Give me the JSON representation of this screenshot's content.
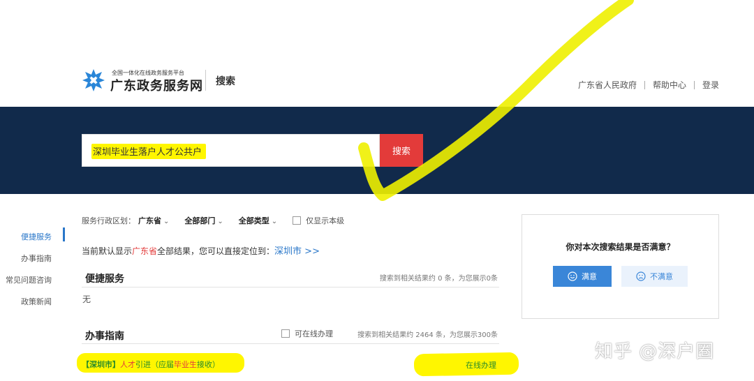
{
  "header": {
    "logo_sub": "全国一体化在线政务服务平台",
    "logo_title": "广东政务服务网",
    "section": "搜索",
    "links": [
      "广东省人民政府",
      "帮助中心",
      "登录"
    ]
  },
  "search": {
    "query": "深圳毕业生落户人才公共户",
    "button": "搜索"
  },
  "nav": {
    "items": [
      "便捷服务",
      "办事指南",
      "常见问题咨询",
      "政策新闻"
    ]
  },
  "filters": {
    "region_label": "服务行政区划：",
    "region_value": "广东省",
    "dept_value": "全部部门",
    "type_value": "全部类型",
    "only_this_level": "仅显示本级"
  },
  "notice": {
    "prefix": "当前默认显示",
    "province": "广东省",
    "middle": "全部结果，您可以直接定位到：",
    "city_link": "深圳市 >>"
  },
  "quick_service": {
    "title": "便捷服务",
    "meta": "搜索到相关结果约 0 条，为您展示0条",
    "empty": "无"
  },
  "guide": {
    "title": "办事指南",
    "online_filter": "可在线办理",
    "meta": "搜索到相关结果约 2464 条，为您展示300条",
    "result": {
      "prefix": "【深圳市】",
      "keyword1": "人才",
      "middle": "引进（应届",
      "keyword2": "毕业生",
      "suffix": "接收）"
    },
    "action": "在线办理"
  },
  "feedback": {
    "question": "你对本次搜索结果是否满意？",
    "yes": "满意",
    "no": "不满意"
  },
  "watermark": "知乎 @深户圈",
  "colors": {
    "banner": "#112a4b",
    "accent_red": "#e33b3a",
    "accent_blue": "#2a77c9",
    "highlight": "#fff600"
  }
}
